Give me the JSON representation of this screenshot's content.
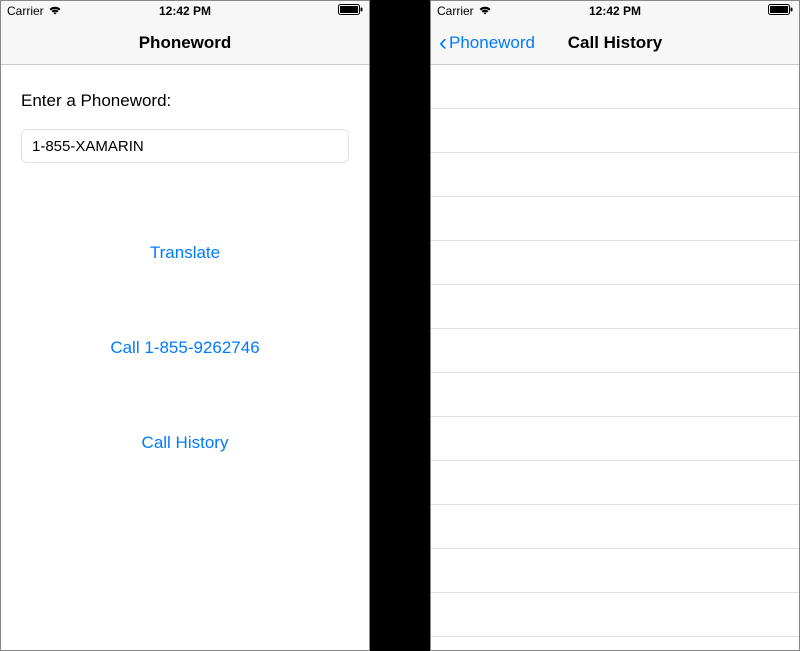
{
  "status": {
    "carrier": "Carrier",
    "time": "12:42 PM"
  },
  "screen1": {
    "nav_title": "Phoneword",
    "label": "Enter a Phoneword:",
    "input_value": "1-855-XAMARIN",
    "translate_label": "Translate",
    "call_label": "Call 1-855-9262746",
    "history_label": "Call History"
  },
  "screen2": {
    "back_label": "Phoneword",
    "nav_title": "Call History",
    "rows": [
      "",
      "",
      "",
      "",
      "",
      "",
      "",
      "",
      "",
      "",
      "",
      "",
      ""
    ]
  },
  "colors": {
    "tint": "#007aff",
    "nav_bg": "#f7f7f7",
    "separator": "#e0e0e0"
  }
}
